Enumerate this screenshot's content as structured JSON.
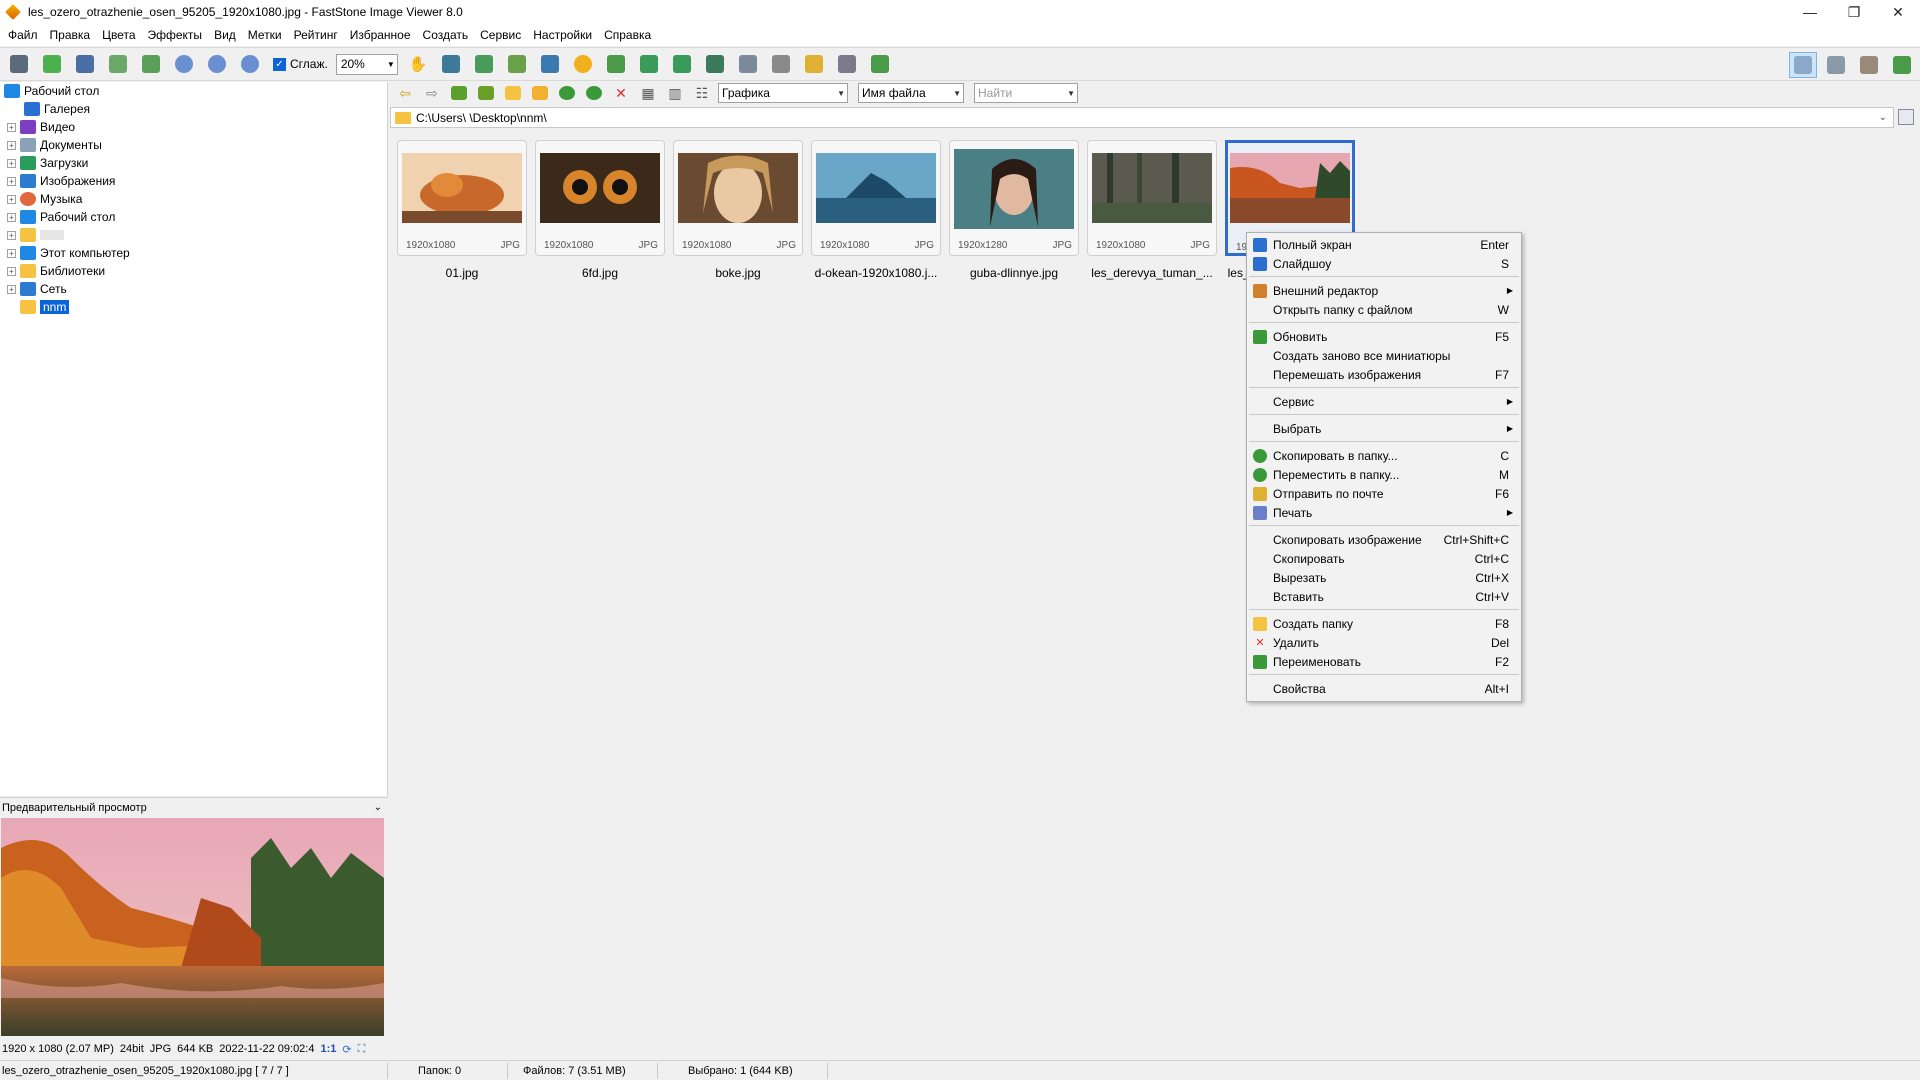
{
  "window": {
    "title": "les_ozero_otrazhenie_osen_95205_1920x1080.jpg  -  FastStone Image Viewer 8.0",
    "controls": [
      "—",
      "❐",
      "✕"
    ]
  },
  "menu": [
    "Файл",
    "Правка",
    "Цвета",
    "Эффекты",
    "Вид",
    "Метки",
    "Рейтинг",
    "Избранное",
    "Создать",
    "Сервис",
    "Настройки",
    "Справка"
  ],
  "toolbar": {
    "smooth_label": "Сглаж.",
    "zoom_value": "20%"
  },
  "tree": {
    "items": [
      {
        "label": "Рабочий стол",
        "icon": "desktop-icon",
        "color": "#1e88e5"
      },
      {
        "label": "Галерея",
        "icon": "gallery-icon",
        "color": "#2b6fd1"
      },
      {
        "label": "Видео",
        "icon": "video-icon",
        "color": "#7b3fbf"
      },
      {
        "label": "Документы",
        "icon": "documents-icon",
        "color": "#8aa1b8"
      },
      {
        "label": "Загрузки",
        "icon": "downloads-icon",
        "color": "#2a9d5a"
      },
      {
        "label": "Изображения",
        "icon": "pictures-icon",
        "color": "#2b7bd1"
      },
      {
        "label": "Музыка",
        "icon": "music-icon",
        "color": "#e0683c"
      },
      {
        "label": "Рабочий стол",
        "icon": "desktop-icon",
        "color": "#1e88e5"
      },
      {
        "label": "",
        "icon": "user-folder-icon",
        "color": "#f5c242"
      },
      {
        "label": "Этот компьютер",
        "icon": "computer-icon",
        "color": "#1e88e5"
      },
      {
        "label": "Библиотеки",
        "icon": "libraries-icon",
        "color": "#f5c242"
      },
      {
        "label": "Сеть",
        "icon": "network-icon",
        "color": "#2b7bd1"
      },
      {
        "label": "nnm",
        "icon": "folder-icon",
        "color": "#f5c242"
      }
    ]
  },
  "preview": {
    "header": "Предварительный просмотр",
    "info": [
      "1920 x 1080 (2.07 MP)",
      "24bit",
      "JPG",
      "644 KB",
      "2022-11-22 09:02:4",
      "1:1"
    ]
  },
  "nav": {
    "filter_value": "Графика",
    "sort_value": "Имя файла",
    "search_placeholder": "Найти",
    "path": "C:\\Users\\      \\Desktop\\nnm\\"
  },
  "thumbs": [
    {
      "name": "01.jpg",
      "res": "1920x1080",
      "type": "JPG",
      "colors": [
        "#f2d6b8",
        "#c56a2b",
        "#7a4a2c"
      ]
    },
    {
      "name": "6fd.jpg",
      "res": "1920x1080",
      "type": "JPG",
      "colors": [
        "#3b2a1a",
        "#b86a23",
        "#2a1c10"
      ]
    },
    {
      "name": "boke.jpg",
      "res": "1920x1080",
      "type": "JPG",
      "colors": [
        "#e8c9a3",
        "#c79a6b",
        "#5d3d27"
      ]
    },
    {
      "name": "d-okean-1920x1080.j...",
      "res": "1920x1080",
      "type": "JPG",
      "colors": [
        "#6aa6c8",
        "#2b5f80",
        "#123347"
      ]
    },
    {
      "name": "guba-dlinnye.jpg",
      "res": "1920x1280",
      "type": "JPG",
      "colors": [
        "#4b7f86",
        "#e0b9a0",
        "#1f3f45"
      ]
    },
    {
      "name": "les_derevya_tuman_...",
      "res": "1920x1080",
      "type": "JPG",
      "colors": [
        "#5a5a4e",
        "#2f3a2c",
        "#7a8a70"
      ]
    },
    {
      "name": "les_ozero_otrazhenie...",
      "res": "1920x1080",
      "type": "JPG",
      "colors": [
        "#e7a7b0",
        "#c8561e",
        "#2f4a2a"
      ]
    }
  ],
  "context_menu": [
    {
      "label": "Полный экран",
      "shortcut": "Enter",
      "icon": "fullscreen-icon",
      "icon_color": "#2b6fd1"
    },
    {
      "label": "Слайдшоу",
      "shortcut": "S",
      "icon": "slideshow-icon",
      "icon_color": "#2b6fd1"
    },
    {
      "sep": true
    },
    {
      "label": "Внешний редактор",
      "submenu": true,
      "icon": "external-editor-icon",
      "icon_color": "#d0802a"
    },
    {
      "label": "Открыть папку с файлом",
      "shortcut": "W"
    },
    {
      "sep": true
    },
    {
      "label": "Обновить",
      "shortcut": "F5",
      "icon": "refresh-icon",
      "icon_color": "#3a9a3a"
    },
    {
      "label": "Создать заново все миниатюры"
    },
    {
      "label": "Перемешать изображения",
      "shortcut": "F7"
    },
    {
      "sep": true
    },
    {
      "label": "Сервис",
      "submenu": true
    },
    {
      "sep": true
    },
    {
      "label": "Выбрать",
      "submenu": true
    },
    {
      "sep": true
    },
    {
      "label": "Скопировать в папку...",
      "shortcut": "C",
      "icon": "copy-to-folder-icon",
      "icon_color": "#3a9a3a"
    },
    {
      "label": "Переместить в папку...",
      "shortcut": "M",
      "icon": "move-to-folder-icon",
      "icon_color": "#3a9a3a"
    },
    {
      "label": "Отправить по почте",
      "shortcut": "F6",
      "icon": "email-icon",
      "icon_color": "#e0b030"
    },
    {
      "label": "Печать",
      "submenu": true,
      "icon": "print-icon",
      "icon_color": "#6a7fc8"
    },
    {
      "sep": true
    },
    {
      "label": "Скопировать изображение",
      "shortcut": "Ctrl+Shift+C"
    },
    {
      "label": "Скопировать",
      "shortcut": "Ctrl+C"
    },
    {
      "label": "Вырезать",
      "shortcut": "Ctrl+X"
    },
    {
      "label": "Вставить",
      "shortcut": "Ctrl+V"
    },
    {
      "sep": true
    },
    {
      "label": "Создать папку",
      "shortcut": "F8",
      "icon": "new-folder-icon",
      "icon_color": "#f5c242"
    },
    {
      "label": "Удалить",
      "shortcut": "Del",
      "icon": "delete-icon",
      "icon_color": "#d83030"
    },
    {
      "label": "Переименовать",
      "shortcut": "F2",
      "icon": "rename-icon",
      "icon_color": "#3a9a3a"
    },
    {
      "sep": true
    },
    {
      "label": "Свойства",
      "shortcut": "Alt+I"
    }
  ],
  "status": {
    "file": "les_ozero_otrazhenie_osen_95205_1920x1080.jpg [ 7 / 7 ]",
    "folders": "Папок: 0",
    "files": "Файлов: 7 (3.51 MB)",
    "selected": "Выбрано: 1 (644 KB)"
  }
}
